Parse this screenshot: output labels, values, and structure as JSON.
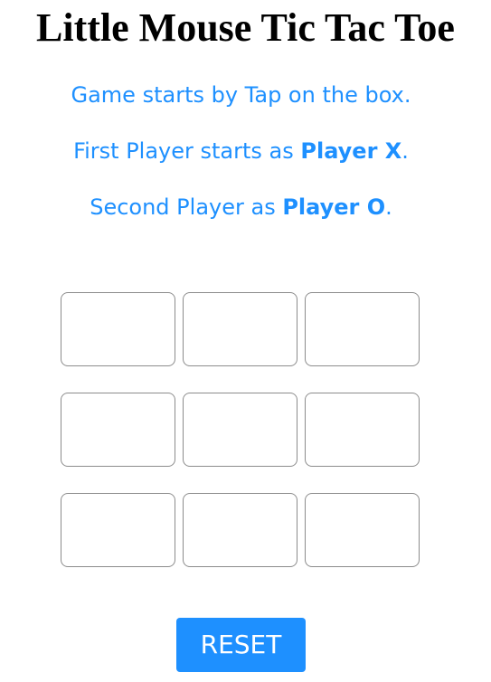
{
  "title": "Little Mouse Tic Tac Toe",
  "instructions": {
    "line1": "Game starts by Tap on the box.",
    "line2_prefix": "First Player starts as ",
    "line2_bold": "Player X",
    "line2_suffix": ".",
    "line3_prefix": "Second Player as ",
    "line3_bold": "Player O",
    "line3_suffix": "."
  },
  "board": {
    "cells": [
      "",
      "",
      "",
      "",
      "",
      "",
      "",
      "",
      ""
    ]
  },
  "reset_label": "RESET",
  "colors": {
    "accent": "#1e90ff",
    "cell_border": "#8c8c8c",
    "title": "#000000"
  }
}
